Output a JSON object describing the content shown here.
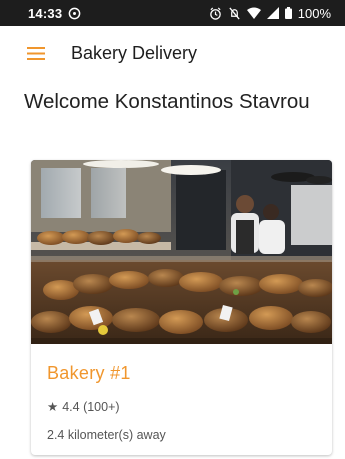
{
  "status_bar": {
    "time": "14:33",
    "battery": "100%"
  },
  "app_bar": {
    "title": "Bakery Delivery",
    "menu_icon": "hamburger-menu-icon",
    "accent_color": "#f0962d"
  },
  "welcome_text": "Welcome Konstantinos Stavrou",
  "bakeries": [
    {
      "name": "Bakery #1",
      "rating_icon": "star-icon",
      "rating": "4.4 (100+)",
      "distance": "2.4 kilometer(s) away"
    }
  ]
}
